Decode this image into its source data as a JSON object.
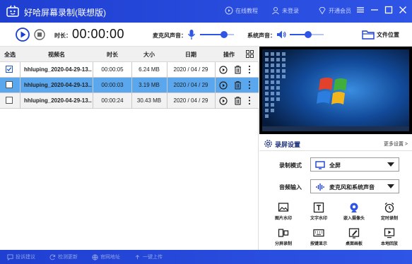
{
  "app": {
    "title": "好哈屏幕录制(联想版)",
    "links": {
      "online_tutorial": "在线教程",
      "login": "未登录",
      "member": "开通会员"
    }
  },
  "controls": {
    "duration_label": "时长：",
    "timer": "00:00:00",
    "mic_label": "麦克风声音：",
    "mic_level": 0.7,
    "system_label": "系统声音：",
    "system_level": 0.55,
    "file_location": "文件位置"
  },
  "table": {
    "headers": {
      "select_all": "全选",
      "name": "视频名",
      "duration": "时长",
      "size": "大小",
      "date": "日期",
      "actions": "操作"
    },
    "rows": [
      {
        "checked": true,
        "name": "hhluping_2020-04-29-13...",
        "duration": "00:00:05",
        "size": "6.24 MB",
        "date": "2020 / 04 / 29"
      },
      {
        "checked": false,
        "name": "hhluping_2020-04-29-13...",
        "duration": "00:00:03",
        "size": "3.19 MB",
        "date": "2020 / 04 / 29"
      },
      {
        "checked": false,
        "name": "hhluping_2020-04-29-13...",
        "duration": "00:00:24",
        "size": "30.43 MB",
        "date": "2020 / 04 / 29"
      }
    ]
  },
  "settings": {
    "title": "录屏设置",
    "more": "更多设置 >",
    "record_mode_label": "录制模式",
    "record_mode_value": "全屏",
    "audio_input_label": "音频输入",
    "audio_input_value": "麦克风和系统声音",
    "tools": [
      {
        "label": "图片水印",
        "icon": "image-watermark-icon"
      },
      {
        "label": "文字水印",
        "icon": "text-watermark-icon"
      },
      {
        "label": "嵌入摄像头",
        "icon": "webcam-icon"
      },
      {
        "label": "定时录制",
        "icon": "alarm-icon"
      },
      {
        "label": "分屏录制",
        "icon": "split-screen-icon"
      },
      {
        "label": "按键显示",
        "icon": "keyboard-icon"
      },
      {
        "label": "桌面画板",
        "icon": "draw-board-icon"
      },
      {
        "label": "本地回放",
        "icon": "playback-icon"
      }
    ]
  },
  "statusbar": {
    "items": [
      "投诉建议",
      "检测更新",
      "官网地址",
      "一键上传"
    ]
  },
  "colors": {
    "brand": "#2f55e6",
    "selected_row": "#5aa7ee"
  }
}
